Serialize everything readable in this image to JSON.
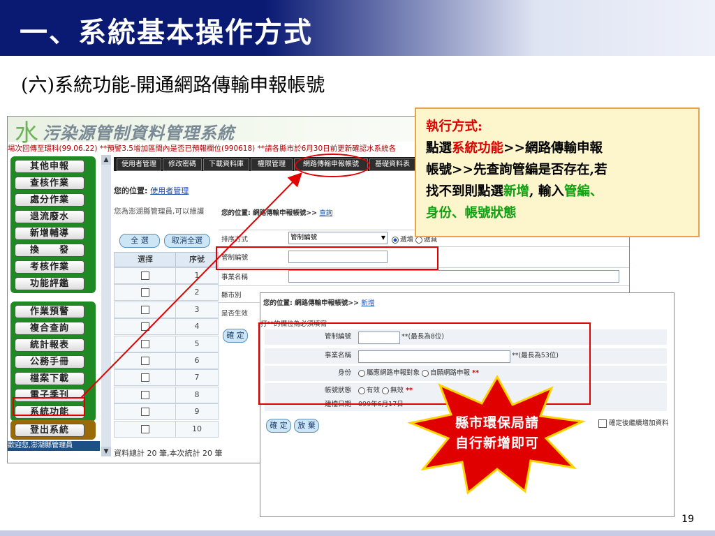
{
  "slide": {
    "title": "一、系統基本操作方式",
    "subtitle": "(六)系統功能-開通網路傳輸申報帳號",
    "page_number": "19"
  },
  "screenshot1": {
    "banner_logo": "水",
    "banner_title": "污染源管制資料管理系統",
    "ticker": "場次回傳至環科(99.06.22) **預警3.5增加區間內是否已預報欄位(990618) **請各縣市於6月30日前更新確認水系統各",
    "menu_group1": [
      "其他申報",
      "查核作業",
      "處分作業",
      "退流廢水",
      "新增輔導",
      "換　　發",
      "考核作業",
      "功能評鑑"
    ],
    "menu_group2": [
      "作業預警",
      "複合查詢",
      "統計報表",
      "公務手冊",
      "檔案下載",
      "電子季刊",
      "系統功能"
    ],
    "menu_group3": [
      "登出系統"
    ],
    "welcome": "歡迎您,澎湖縣管理員",
    "top_nav": [
      "使用者管理",
      "修改密碼",
      "下載資料庫",
      "權限管理",
      "網路傳輸申報帳號",
      "基礎資料表"
    ],
    "location_label": "您的位置:",
    "location_link": "使用者管理",
    "admin_text": "您為澎湖縣管理員,可以維護",
    "select_all": "全 選",
    "deselect_all": "取消全選",
    "table_headers": [
      "選擇",
      "序號"
    ],
    "rows": [
      "1",
      "2",
      "3",
      "4",
      "5",
      "6",
      "7",
      "8",
      "9",
      "10"
    ],
    "total_text": "資料總計 20 筆,本次統計 20 筆"
  },
  "panel2": {
    "location": "您的位置: 網路傳輸申報帳號>>",
    "location_link": "查詢",
    "fields": [
      "排序方式",
      "管制編號",
      "事業名稱",
      "縣市別",
      "是否生效"
    ],
    "sort_value": "管制編號",
    "sort_radio_1": "遞增",
    "sort_radio_2": "遞減",
    "confirm": "確 定"
  },
  "screenshot2": {
    "location": "您的位置: 網路傳輸申報帳號>>",
    "location_link": "新增",
    "required_note": "打**的欄位為必須填寫",
    "label_id": "管制編號",
    "hint_id": "**(最長為8位)",
    "label_name": "事業名稱",
    "hint_name": "**(最長為53位)",
    "label_identity": "身份",
    "identity_opt1": "屬應網路申報對象",
    "identity_opt2": "自願網路申報",
    "label_status": "帳號狀態",
    "status_opt1": "有效",
    "status_opt2": "無效",
    "label_date": "建檔日期",
    "date_value": "099年6月17日",
    "confirm": "確 定",
    "cancel": "放 棄",
    "continue_add": "確定後繼續增加資料",
    "required_mark": "**"
  },
  "annotation": {
    "line1": "執行方式:",
    "line2_a": "點選",
    "line2_b": "系統功能",
    "line2_c": ">>網路傳輸申報",
    "line3": "帳號>>先查詢管編是否存在,若",
    "line4_a": "找不到則點選",
    "line4_b": "新增",
    "line4_c": ", 輸入",
    "line4_d": "管編、",
    "line5": "身份、帳號狀態"
  },
  "starburst": {
    "line1": "縣市環保局請",
    "line2": "自行新增即可"
  },
  "colors": {
    "header": "#0a1a73",
    "highlight": "#e00000",
    "menu_green": "#1f8a24"
  }
}
